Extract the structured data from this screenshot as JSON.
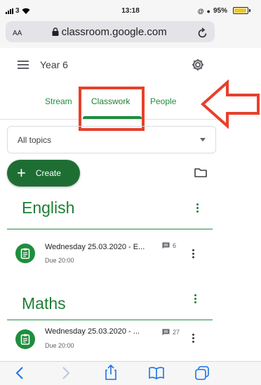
{
  "status_bar": {
    "carrier": "3",
    "time": "13:18",
    "battery": "95%",
    "battery_level": 0.95
  },
  "browser": {
    "text_size_label": "AA",
    "url": "classroom.google.com"
  },
  "header": {
    "class_name": "Year 6"
  },
  "tabs": [
    {
      "label": "Stream",
      "selected": false
    },
    {
      "label": "Classwork",
      "selected": true
    },
    {
      "label": "People",
      "selected": false
    }
  ],
  "filter": {
    "selected": "All topics"
  },
  "create_button": {
    "label": "Create"
  },
  "topics": [
    {
      "title": "English",
      "items": [
        {
          "title": "Wednesday 25.03.2020 - E...",
          "due": "Due 20:00",
          "comments": "6"
        }
      ]
    },
    {
      "title": "Maths",
      "items": [
        {
          "title": "Wednesday 25.03.2020 -  ...",
          "due": "Due 20:00",
          "comments": "27"
        }
      ]
    }
  ],
  "colors": {
    "accent": "#1e8e3e",
    "annotation": "#e7402b",
    "battery": "#f4c41f"
  },
  "icons": [
    "signal-icon",
    "wifi-icon",
    "lock-icon",
    "reload-icon",
    "menu-icon",
    "gear-icon",
    "folder-icon",
    "assignment-icon",
    "comment-icon",
    "back-icon",
    "forward-icon",
    "share-icon",
    "bookmarks-icon",
    "tabs-icon"
  ]
}
